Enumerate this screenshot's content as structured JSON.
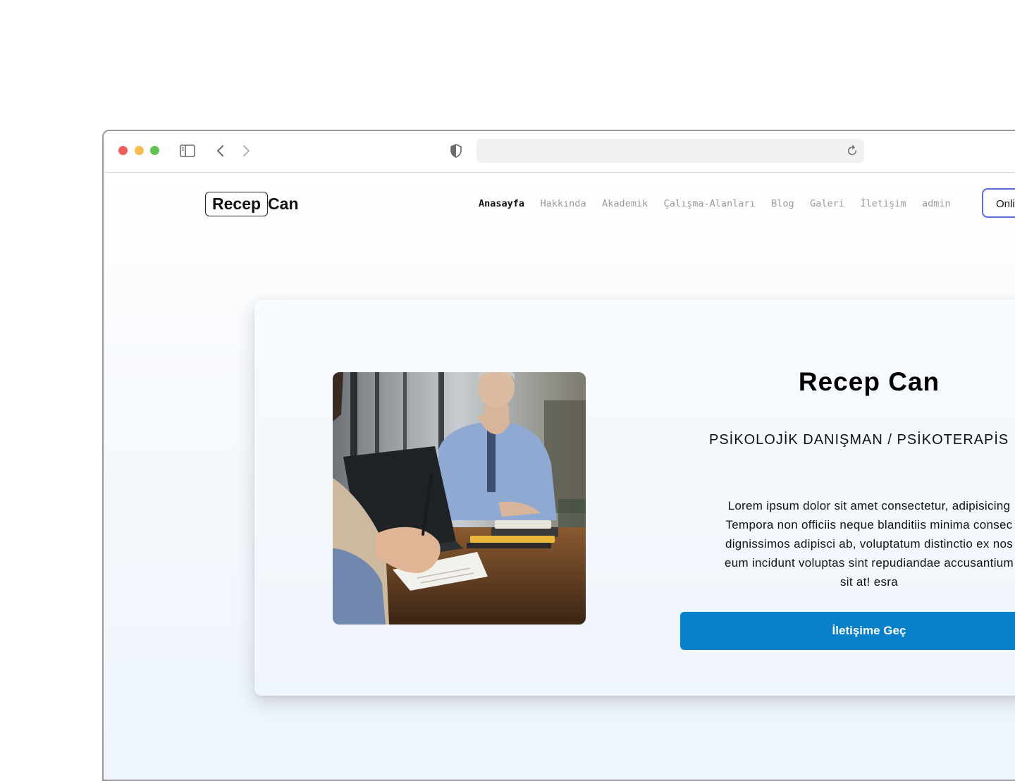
{
  "browser": {
    "icons": [
      "sidebar-icon",
      "back-icon",
      "forward-icon",
      "shield-icon",
      "reload-icon"
    ],
    "url": ""
  },
  "nav": {
    "logo_boxed": "Recep",
    "logo_rest": "Can",
    "links": [
      {
        "label": "Anasayfa",
        "active": true
      },
      {
        "label": "Hakkında"
      },
      {
        "label": "Akademik"
      },
      {
        "label": "Çalışma-Alanları"
      },
      {
        "label": "Blog"
      },
      {
        "label": "Galeri"
      },
      {
        "label": "İletişim"
      },
      {
        "label": "admin"
      }
    ],
    "online_button": "Onli"
  },
  "hero": {
    "title": "Recep Can",
    "subtitle": "PSİKOLOJİK DANIŞMAN / PSİKOTERAPİS",
    "text_lines": [
      "Lorem ipsum dolor sit amet consectetur, adipisicing",
      "Tempora non officiis neque blanditiis minima consec",
      "dignissimos adipisci ab, voluptatum distinctio ex nos",
      "eum incidunt voluptas sint repudiandae accusantium",
      "sit at! esra"
    ],
    "cta_label": "İletişime Geç",
    "photo_icon": "counseling-session-photo"
  },
  "colors": {
    "accent": "#0681c9",
    "online_border": "#5b6fd6"
  }
}
